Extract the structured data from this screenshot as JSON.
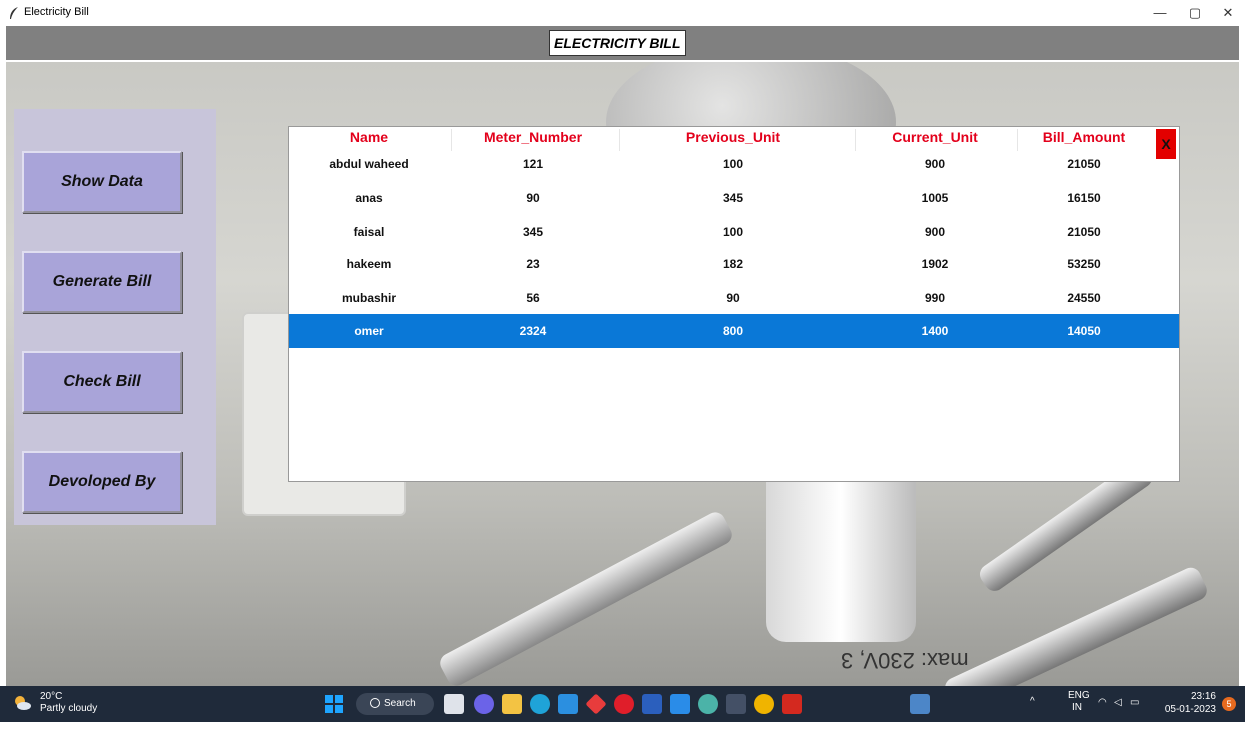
{
  "window": {
    "title": "Electricity Bill",
    "minimize": "—",
    "maximize": "▢",
    "close": "✕"
  },
  "header": {
    "title": "ELECTRICITY BILL"
  },
  "sidebar": {
    "buttons": [
      {
        "label": "Show Data"
      },
      {
        "label": "Generate Bill"
      },
      {
        "label": "Check Bill"
      },
      {
        "label": "Devoloped By"
      }
    ]
  },
  "table": {
    "columns": [
      "Name",
      "Meter_Number",
      "Previous_Unit",
      "Current_Unit",
      "Bill_Amount"
    ],
    "close_label": "X",
    "rows": [
      {
        "name": "abdul waheed",
        "meter": "121",
        "prev": "100",
        "curr": "900",
        "amount": "21050"
      },
      {
        "name": "anas",
        "meter": "90",
        "prev": "345",
        "curr": "1005",
        "amount": "16150"
      },
      {
        "name": "faisal",
        "meter": "345",
        "prev": "100",
        "curr": "900",
        "amount": "21050"
      },
      {
        "name": "hakeem",
        "meter": "23",
        "prev": "182",
        "curr": "1902",
        "amount": "53250"
      },
      {
        "name": "mubashir",
        "meter": "56",
        "prev": "90",
        "curr": "990",
        "amount": "24550"
      },
      {
        "name": "omer",
        "meter": "2324",
        "prev": "800",
        "curr": "1400",
        "amount": "14050"
      }
    ],
    "selected_row": "omer"
  },
  "background": {
    "label": "max: 230V, 3"
  },
  "taskbar": {
    "weather_temp": "20°C",
    "weather_cond": "Partly cloudy",
    "search_label": "Search",
    "lang_top": "ENG",
    "lang_bottom": "IN",
    "time": "23:16",
    "date": "05-01-2023",
    "notification_count": "5"
  },
  "colors": {
    "header_text": "#e3001b",
    "selected_row": "#0a78d7",
    "side_button": "#a9a4d9",
    "close_button": "#e30000"
  }
}
